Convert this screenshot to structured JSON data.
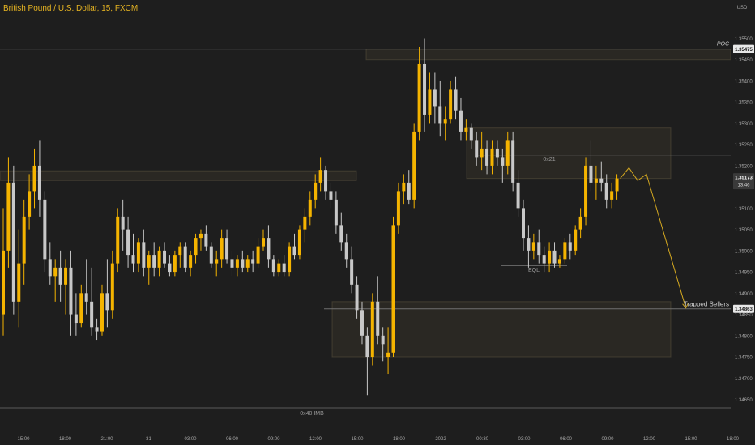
{
  "title": "British Pound / U.S. Dollar, 15, FXCM",
  "chart_data": {
    "type": "candlestick",
    "currency_label": "USD",
    "y_ticks": [
      1.3465,
      1.347,
      1.3475,
      1.348,
      1.3485,
      1.349,
      1.3495,
      1.35,
      1.3505,
      1.351,
      1.3515,
      1.352,
      1.3525,
      1.353,
      1.3535,
      1.354,
      1.3545,
      1.355
    ],
    "y_tick_labels": [
      "1.34650",
      "1.34700",
      "1.34750",
      "1.34800",
      "1.34850",
      "1.34900",
      "1.34950",
      "1.35000",
      "1.35050",
      "1.35100",
      "1.35150",
      "1.35200",
      "1.35250",
      "1.35300",
      "1.35350",
      "1.35400",
      "1.35450",
      "1.35500"
    ],
    "x_tick_labels": [
      "15:00",
      "18:00",
      "21:00",
      "31",
      "03:00",
      "06:00",
      "09:00",
      "12:00",
      "15:00",
      "18:00",
      "2022",
      "00:30",
      "03:00",
      "06:00",
      "09:00",
      "12:00",
      "15:00",
      "18:00"
    ],
    "ylim": [
      1.3459,
      1.3556
    ],
    "last_price": "1.35173",
    "countdown": "13:46",
    "poc": {
      "label": "POC",
      "price": 1.35475,
      "price_label": "1.35475"
    },
    "trapped_sellers": {
      "label": "Trapped Sellers",
      "price": 1.34863,
      "price_label": "1.34863"
    },
    "annotations": {
      "ob_upper": "0x21",
      "eql": "EQL",
      "ob_lower": "0x40 IMB"
    },
    "zones": [
      {
        "name": "top-zone",
        "y1": 1.35475,
        "y2": 1.3545
      },
      {
        "name": "upper-ob",
        "y1": 1.3529,
        "y2": 1.3517
      },
      {
        "name": "mid-zone",
        "y1": 1.35188,
        "y2": 1.35165
      },
      {
        "name": "lower-ob",
        "y1": 1.3488,
        "y2": 1.3475
      }
    ],
    "candles": [
      [
        1.3485,
        1.351,
        1.348,
        1.35
      ],
      [
        1.35,
        1.3522,
        1.3496,
        1.3516
      ],
      [
        1.3516,
        1.352,
        1.3485,
        1.3488
      ],
      [
        1.3488,
        1.3505,
        1.3482,
        1.3497
      ],
      [
        1.3497,
        1.3512,
        1.3492,
        1.3508
      ],
      [
        1.3508,
        1.3518,
        1.3505,
        1.3514
      ],
      [
        1.3514,
        1.3524,
        1.351,
        1.352
      ],
      [
        1.352,
        1.3526,
        1.3508,
        1.3512
      ],
      [
        1.3512,
        1.3514,
        1.3495,
        1.3498
      ],
      [
        1.3498,
        1.3502,
        1.3492,
        1.3494
      ],
      [
        1.3494,
        1.3498,
        1.3488,
        1.3496
      ],
      [
        1.3496,
        1.35,
        1.3488,
        1.3492
      ],
      [
        1.3492,
        1.3498,
        1.3485,
        1.3496
      ],
      [
        1.3496,
        1.35,
        1.348,
        1.3485
      ],
      [
        1.3485,
        1.349,
        1.348,
        1.3483
      ],
      [
        1.3483,
        1.3492,
        1.3482,
        1.349
      ],
      [
        1.349,
        1.3498,
        1.3485,
        1.3488
      ],
      [
        1.3488,
        1.3496,
        1.348,
        1.3482
      ],
      [
        1.3482,
        1.3484,
        1.3479,
        1.3481
      ],
      [
        1.3481,
        1.3492,
        1.348,
        1.349
      ],
      [
        1.349,
        1.3498,
        1.3482,
        1.3486
      ],
      [
        1.3486,
        1.35,
        1.3484,
        1.3497
      ],
      [
        1.3497,
        1.351,
        1.3495,
        1.3508
      ],
      [
        1.3508,
        1.3512,
        1.35,
        1.3505
      ],
      [
        1.3505,
        1.3508,
        1.3496,
        1.3499
      ],
      [
        1.3499,
        1.3504,
        1.3495,
        1.3497
      ],
      [
        1.3497,
        1.3503,
        1.3495,
        1.3502
      ],
      [
        1.3502,
        1.3505,
        1.3494,
        1.3496
      ],
      [
        1.3496,
        1.35,
        1.3492,
        1.3499
      ],
      [
        1.3499,
        1.3502,
        1.3494,
        1.3496
      ],
      [
        1.3496,
        1.3501,
        1.3494,
        1.35
      ],
      [
        1.35,
        1.3502,
        1.3496,
        1.3497
      ],
      [
        1.3497,
        1.3499,
        1.3494,
        1.3495
      ],
      [
        1.3495,
        1.35,
        1.3494,
        1.3499
      ],
      [
        1.3499,
        1.3502,
        1.3496,
        1.3501
      ],
      [
        1.3501,
        1.3502,
        1.3495,
        1.3496
      ],
      [
        1.3496,
        1.35,
        1.3494,
        1.3499
      ],
      [
        1.3499,
        1.3504,
        1.3497,
        1.3503
      ],
      [
        1.3503,
        1.3505,
        1.35,
        1.3504
      ],
      [
        1.3504,
        1.3506,
        1.35,
        1.3501
      ],
      [
        1.3501,
        1.3502,
        1.3496,
        1.3497
      ],
      [
        1.3497,
        1.35,
        1.3494,
        1.3498
      ],
      [
        1.3498,
        1.3505,
        1.3496,
        1.3503
      ],
      [
        1.3503,
        1.3505,
        1.3497,
        1.3498
      ],
      [
        1.3498,
        1.35,
        1.3494,
        1.3496
      ],
      [
        1.3496,
        1.3499,
        1.3494,
        1.3498
      ],
      [
        1.3498,
        1.35,
        1.3495,
        1.3496
      ],
      [
        1.3496,
        1.3499,
        1.3495,
        1.3498
      ],
      [
        1.3498,
        1.35,
        1.3495,
        1.3497
      ],
      [
        1.3497,
        1.3503,
        1.3496,
        1.3501
      ],
      [
        1.3501,
        1.3505,
        1.35,
        1.3503
      ],
      [
        1.3503,
        1.3506,
        1.3496,
        1.3498
      ],
      [
        1.3498,
        1.3499,
        1.3494,
        1.3495
      ],
      [
        1.3495,
        1.3498,
        1.3494,
        1.3497
      ],
      [
        1.3497,
        1.3499,
        1.3494,
        1.3495
      ],
      [
        1.3495,
        1.3502,
        1.3494,
        1.3501
      ],
      [
        1.3501,
        1.3504,
        1.3498,
        1.3499
      ],
      [
        1.3499,
        1.3506,
        1.3498,
        1.3505
      ],
      [
        1.3505,
        1.351,
        1.3502,
        1.3508
      ],
      [
        1.3508,
        1.3514,
        1.3506,
        1.3512
      ],
      [
        1.3512,
        1.3518,
        1.351,
        1.3516
      ],
      [
        1.3516,
        1.3522,
        1.3514,
        1.3519
      ],
      [
        1.3519,
        1.352,
        1.3512,
        1.3514
      ],
      [
        1.3514,
        1.3516,
        1.351,
        1.3512
      ],
      [
        1.3512,
        1.3514,
        1.3504,
        1.3506
      ],
      [
        1.3506,
        1.3509,
        1.35,
        1.3502
      ],
      [
        1.3502,
        1.3504,
        1.3496,
        1.3498
      ],
      [
        1.3498,
        1.3501,
        1.349,
        1.3492
      ],
      [
        1.3492,
        1.3494,
        1.3484,
        1.3486
      ],
      [
        1.3486,
        1.3488,
        1.3478,
        1.348
      ],
      [
        1.348,
        1.3482,
        1.3466,
        1.3475
      ],
      [
        1.3475,
        1.349,
        1.3473,
        1.3488
      ],
      [
        1.3488,
        1.3494,
        1.3478,
        1.348
      ],
      [
        1.348,
        1.3482,
        1.3474,
        1.3478
      ],
      [
        1.3475,
        1.3482,
        1.3471,
        1.3476
      ],
      [
        1.3476,
        1.3508,
        1.3475,
        1.3506
      ],
      [
        1.3506,
        1.3516,
        1.3504,
        1.3514
      ],
      [
        1.3514,
        1.3518,
        1.3511,
        1.3516
      ],
      [
        1.3516,
        1.3519,
        1.3511,
        1.3512
      ],
      [
        1.3512,
        1.353,
        1.351,
        1.3528
      ],
      [
        1.3528,
        1.3548,
        1.3526,
        1.3544
      ],
      [
        1.3544,
        1.355,
        1.3528,
        1.3532
      ],
      [
        1.3532,
        1.3542,
        1.353,
        1.3538
      ],
      [
        1.3538,
        1.3542,
        1.353,
        1.3534
      ],
      [
        1.3534,
        1.354,
        1.3527,
        1.353
      ],
      [
        1.353,
        1.3534,
        1.3526,
        1.3531
      ],
      [
        1.3531,
        1.354,
        1.353,
        1.3538
      ],
      [
        1.3538,
        1.3541,
        1.3531,
        1.3533
      ],
      [
        1.3533,
        1.3536,
        1.3526,
        1.3528
      ],
      [
        1.3528,
        1.3531,
        1.3526,
        1.3529
      ],
      [
        1.3529,
        1.353,
        1.3524,
        1.3526
      ],
      [
        1.3526,
        1.3528,
        1.352,
        1.3522
      ],
      [
        1.3522,
        1.3528,
        1.3519,
        1.3524
      ],
      [
        1.3524,
        1.3526,
        1.3518,
        1.352
      ],
      [
        1.352,
        1.3526,
        1.3518,
        1.3524
      ],
      [
        1.3524,
        1.3526,
        1.352,
        1.3522
      ],
      [
        1.3522,
        1.3524,
        1.3516,
        1.352
      ],
      [
        1.352,
        1.3528,
        1.3518,
        1.3526
      ],
      [
        1.3526,
        1.3528,
        1.3514,
        1.3516
      ],
      [
        1.3516,
        1.3519,
        1.3508,
        1.351
      ],
      [
        1.351,
        1.3512,
        1.35,
        1.3503
      ],
      [
        1.3503,
        1.3506,
        1.3496,
        1.35
      ],
      [
        1.35,
        1.3504,
        1.3498,
        1.3502
      ],
      [
        1.3502,
        1.3505,
        1.3497,
        1.3499
      ],
      [
        1.3499,
        1.3501,
        1.3495,
        1.3497
      ],
      [
        1.3497,
        1.3502,
        1.3495,
        1.35
      ],
      [
        1.35,
        1.3502,
        1.3496,
        1.3497
      ],
      [
        1.3497,
        1.3499,
        1.3496,
        1.3498
      ],
      [
        1.3498,
        1.3503,
        1.3497,
        1.3502
      ],
      [
        1.3502,
        1.3504,
        1.3498,
        1.35
      ],
      [
        1.35,
        1.3506,
        1.3499,
        1.3505
      ],
      [
        1.3505,
        1.351,
        1.3503,
        1.3508
      ],
      [
        1.3508,
        1.3522,
        1.3506,
        1.352
      ],
      [
        1.352,
        1.3526,
        1.3514,
        1.3516
      ],
      [
        1.3516,
        1.352,
        1.3512,
        1.3517
      ],
      [
        1.3517,
        1.3521,
        1.3514,
        1.3516
      ],
      [
        1.3516,
        1.3518,
        1.351,
        1.3512
      ],
      [
        1.3512,
        1.3516,
        1.351,
        1.3514
      ],
      [
        1.3514,
        1.3518,
        1.3512,
        1.3517
      ]
    ],
    "projection": [
      [
        1.3517,
        0
      ],
      [
        1.35195,
        2
      ],
      [
        1.35165,
        4
      ],
      [
        1.3518,
        6
      ],
      [
        1.34865,
        15
      ]
    ]
  }
}
